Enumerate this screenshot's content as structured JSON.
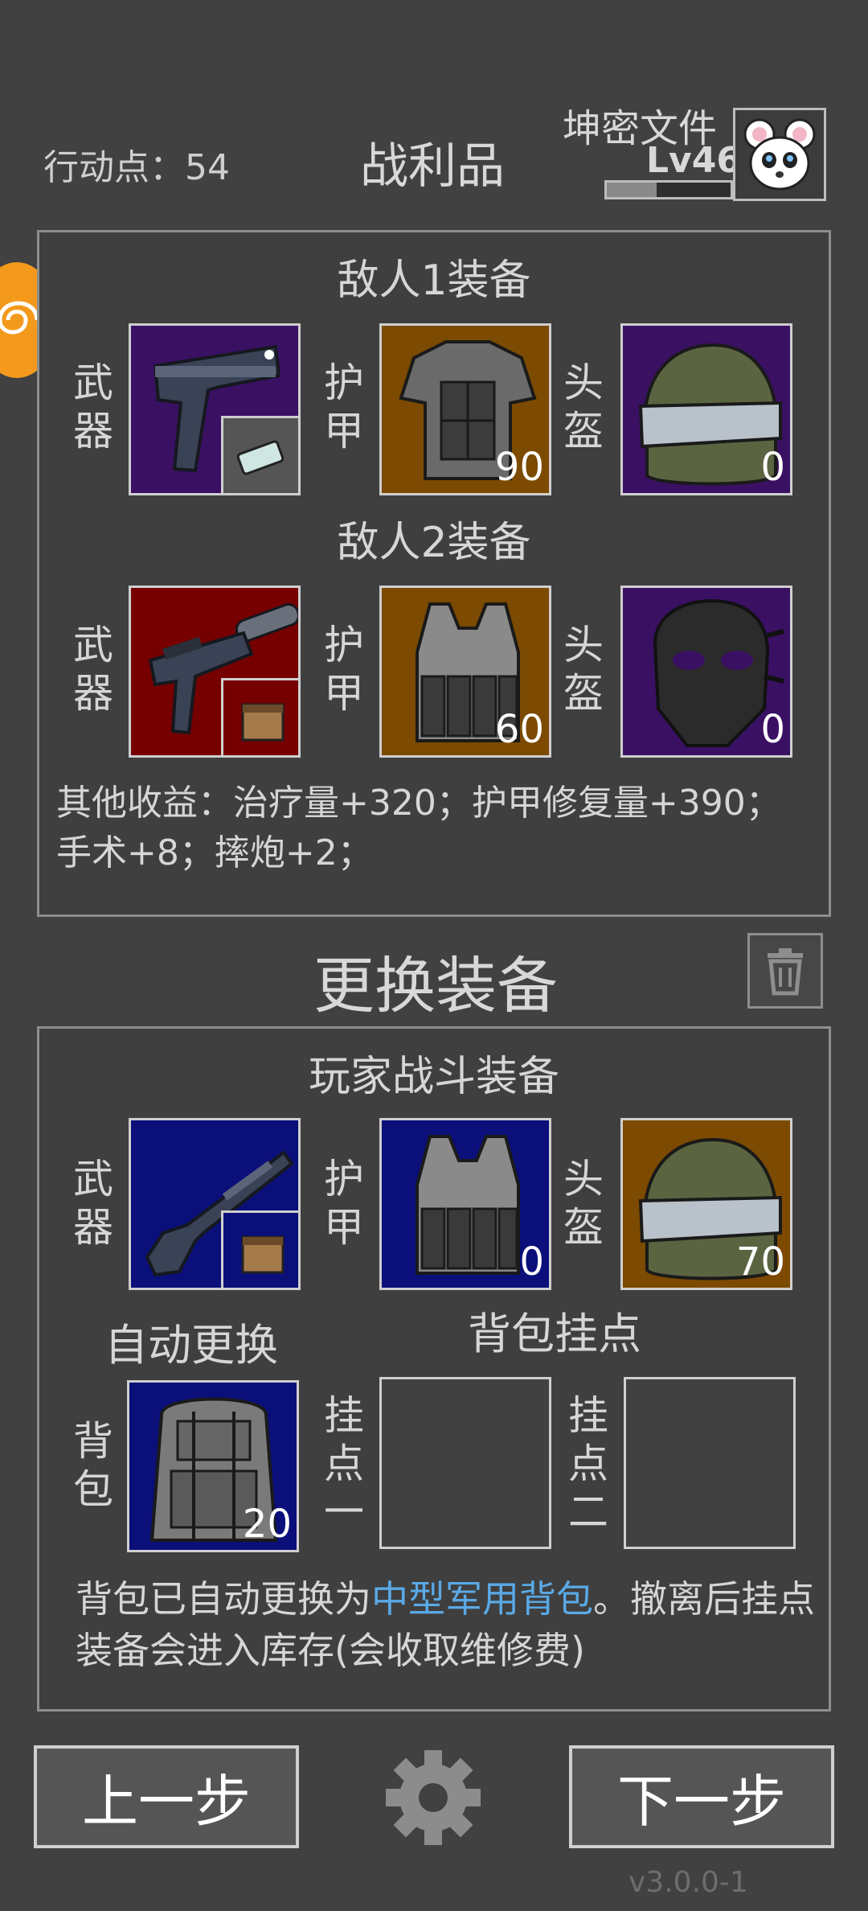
{
  "header": {
    "action_points_label": "行动点：54",
    "title": "战利品",
    "player_name": "坤密文件",
    "player_level": "Lv46",
    "xp_progress": 0.4
  },
  "loot": {
    "enemy1_title": "敌人1装备",
    "enemy2_title": "敌人2装备",
    "labels": {
      "weapon": "武器",
      "armor": "护甲",
      "helmet": "头盔"
    },
    "enemy1": {
      "weapon": {
        "icon": "pistol-icon",
        "ammo_icon": "ammo-clip-icon"
      },
      "armor": {
        "icon": "heavy-armor-icon",
        "durability": "90"
      },
      "helmet": {
        "icon": "visor-helmet-icon",
        "durability": "0"
      }
    },
    "enemy2": {
      "weapon": {
        "icon": "smg-icon",
        "ammo_icon": "ammo-box-icon"
      },
      "armor": {
        "icon": "plate-carrier-icon",
        "durability": "60"
      },
      "helmet": {
        "icon": "face-mask-icon",
        "durability": "0"
      }
    },
    "other_income": "其他收益：治疗量+320；护甲修复量+390；手术+8；摔炮+2；"
  },
  "change": {
    "title": "更换装备"
  },
  "player": {
    "title": "玩家战斗装备",
    "weapon": {
      "icon": "shotgun-icon",
      "ammo_icon": "ammo-box-icon"
    },
    "armor": {
      "icon": "plate-carrier-icon",
      "durability": "0"
    },
    "helmet": {
      "icon": "visor-helmet-icon",
      "durability": "70"
    },
    "auto_replace_title": "自动更换",
    "backpack_mounts_title": "背包挂点",
    "backpack_label": "背包",
    "backpack": {
      "icon": "backpack-icon",
      "durability": "20"
    },
    "mount1_label": "挂点一",
    "mount2_label": "挂点二",
    "note_prefix": "背包已自动更换为",
    "note_highlight": "中型军用背包",
    "note_suffix": "。撤离后挂点装备会进入库存(会收取维修费)"
  },
  "footer": {
    "prev_label": "上一步",
    "next_label": "下一步",
    "version": "v3.0.0-1"
  }
}
